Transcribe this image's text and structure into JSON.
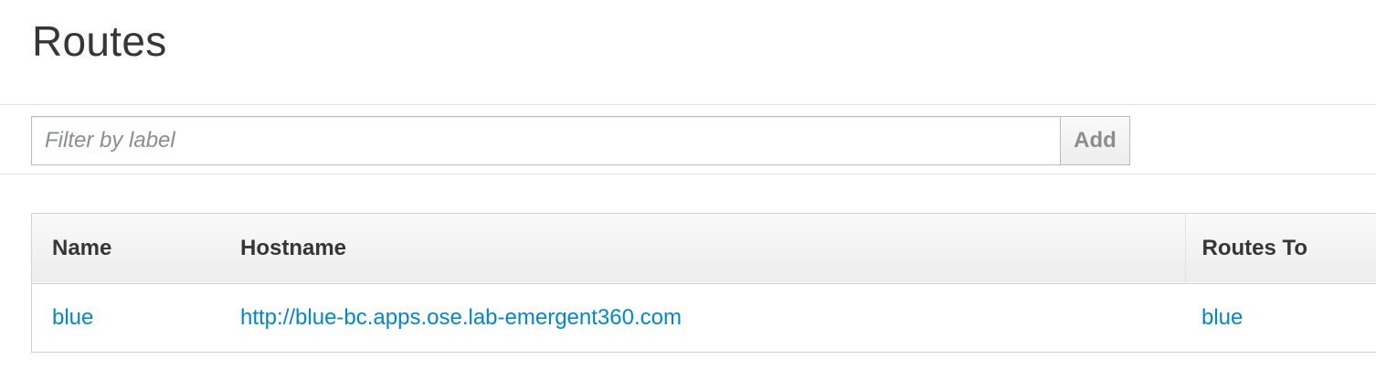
{
  "page": {
    "title": "Routes"
  },
  "filter": {
    "placeholder": "Filter by label",
    "value": "",
    "add_label": "Add"
  },
  "table": {
    "headers": {
      "name": "Name",
      "hostname": "Hostname",
      "routes_to": "Routes To"
    },
    "rows": [
      {
        "name": "blue",
        "hostname": "http://blue-bc.apps.ose.lab-emergent360.com",
        "routes_to": "blue"
      }
    ]
  },
  "colors": {
    "link": "#0088ce",
    "text": "#363636",
    "placeholder": "#8b8d8f",
    "border": "#d1d1d1"
  }
}
